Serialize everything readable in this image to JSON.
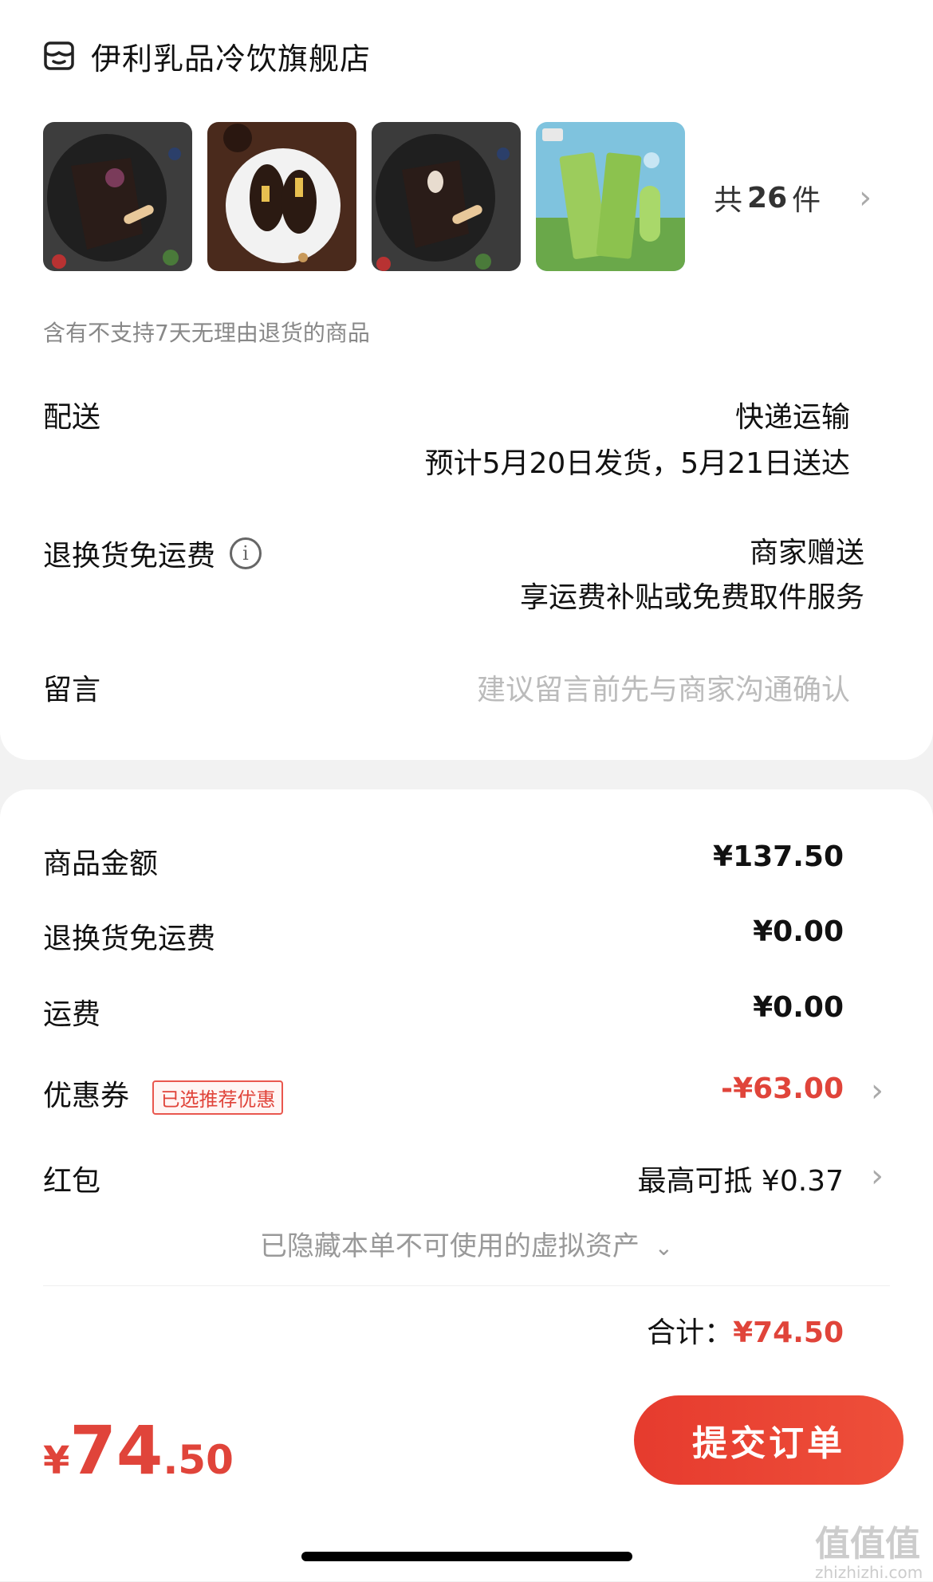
{
  "store": {
    "name": "伊利乳品冷饮旗舰店",
    "icon": "store-icon"
  },
  "products": {
    "thumbnails": [
      "chocolate-ice-cream-bar-image",
      "chocolate-bar-plate-image",
      "chocolate-ice-cream-bar-image",
      "green-bean-popsicle-image"
    ],
    "total_prefix": "共",
    "total_count": "26",
    "total_suffix": "件"
  },
  "return_notice": "含有不支持7天无理由退货的商品",
  "delivery": {
    "label": "配送",
    "method": "快递运输",
    "estimate": "预计5月20日发货，5月21日送达"
  },
  "return_shipping": {
    "label": "退换货免运费",
    "value": "商家赠送",
    "desc": "享运费补贴或免费取件服务"
  },
  "message": {
    "label": "留言",
    "placeholder": "建议留言前先与商家沟通确认"
  },
  "price_breakdown": {
    "goods_label": "商品金额",
    "goods_value": "¥137.50",
    "return_fee_label": "退换货免运费",
    "return_fee_value": "¥0.00",
    "shipping_label": "运费",
    "shipping_value": "¥0.00",
    "coupon_label": "优惠券",
    "coupon_badge": "已选推荐优惠",
    "coupon_value": "-¥63.00",
    "redpacket_label": "红包",
    "redpacket_value": "最高可抵 ¥0.37",
    "hidden_assets": "已隐藏本单不可使用的虚拟资产",
    "sum_label": "合计：",
    "sum_value": "¥74.50"
  },
  "footer": {
    "pay_symbol": "¥",
    "pay_int": "74",
    "pay_dec": ".50",
    "submit_label": "提交订单"
  },
  "watermark": {
    "main": "值值值",
    "sub": "zhizhizhi.com"
  },
  "colors": {
    "accent": "#e0443a",
    "muted": "#999999"
  }
}
